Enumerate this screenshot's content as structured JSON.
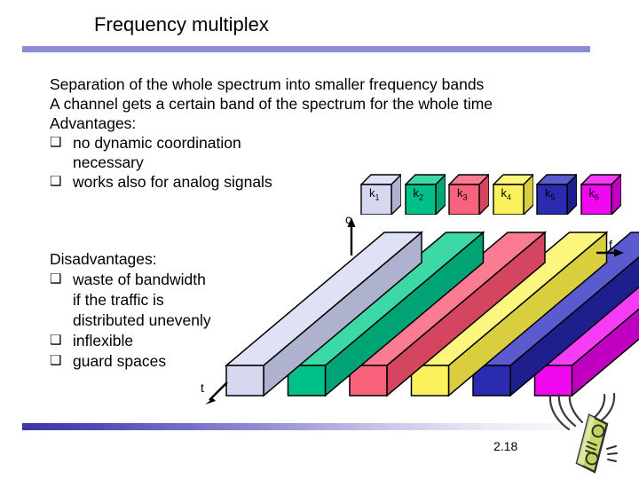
{
  "slide": {
    "title": "Frequency multiplex",
    "page_number": "2.18"
  },
  "body": {
    "intro_lines": [
      "Separation of the whole spectrum into smaller frequency bands",
      "A channel gets a certain band of the spectrum for the whole time"
    ],
    "advantages_heading": "Advantages:",
    "advantages": [
      {
        "bullet": "❑",
        "text": "no dynamic coordination",
        "continuation": "necessary"
      },
      {
        "bullet": "❑",
        "text": "works also for analog signals",
        "continuation": ""
      }
    ],
    "disadvantages_heading": "Disadvantages:",
    "disadvantages": [
      {
        "bullet": "❑",
        "text": "waste of bandwidth",
        "continuation1": "if the traffic is",
        "continuation2": "distributed unevenly"
      },
      {
        "bullet": "❑",
        "text": "inflexible",
        "continuation1": "",
        "continuation2": ""
      },
      {
        "bullet": "❑",
        "text": "guard spaces",
        "continuation1": "",
        "continuation2": ""
      }
    ]
  },
  "diagram": {
    "axes": [
      {
        "name": "c",
        "label": "c",
        "direction": "up"
      },
      {
        "name": "f",
        "label": "f",
        "direction": "right"
      },
      {
        "name": "t",
        "label": "t",
        "direction": "down-left"
      }
    ],
    "channels": [
      {
        "label": "k",
        "subscript": "1",
        "front": "#D6D8EF",
        "top": "#DFE1F5",
        "side": "#AEB2CE"
      },
      {
        "label": "k",
        "subscript": "2",
        "front": "#00C08A",
        "top": "#3CD8A6",
        "side": "#00A374"
      },
      {
        "label": "k",
        "subscript": "3",
        "front": "#F9627D",
        "top": "#FB7C92",
        "side": "#D4455F"
      },
      {
        "label": "k",
        "subscript": "4",
        "front": "#FAF15C",
        "top": "#FCF67E",
        "side": "#D9CF3E"
      },
      {
        "label": "k",
        "subscript": "5",
        "front": "#2B2BB0",
        "top": "#5B5BD0",
        "side": "#1E1E8C"
      },
      {
        "label": "k",
        "subscript": "6",
        "front": "#F009F0",
        "top": "#F63CF6",
        "side": "#C000C0"
      }
    ],
    "theme": {
      "title_rule": "#8B8BD6",
      "bottom_rule_start": "#3B35A8",
      "bottom_rule_end": "#FFFFFF",
      "outline": "#000000"
    }
  },
  "phone": {
    "name": "mobile-phone-with-signal-waves",
    "body_color": "#C6DA6A",
    "key_color": "#BBD45E",
    "outline": "#1a1a1a"
  }
}
